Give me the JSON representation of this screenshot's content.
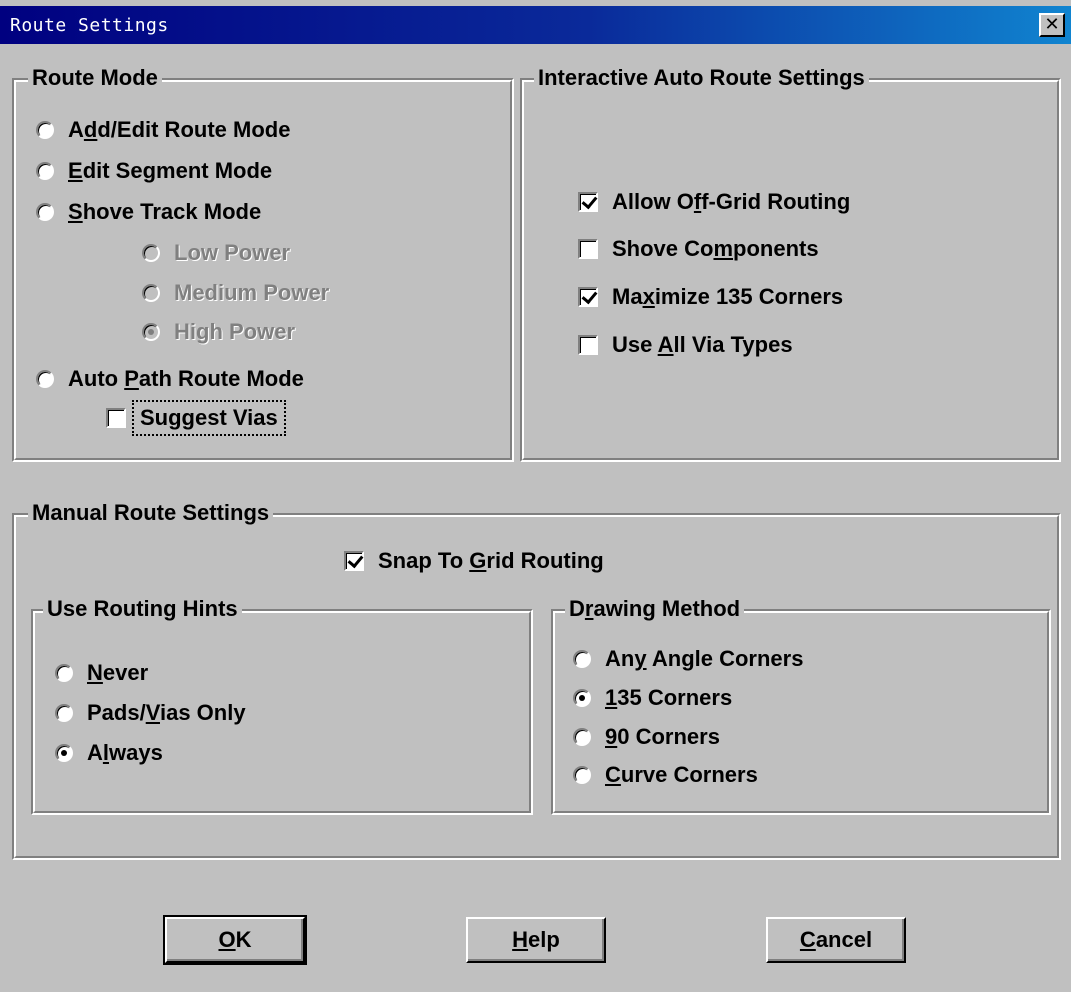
{
  "window": {
    "title": "Route Settings",
    "close_glyph": "✕"
  },
  "route_mode": {
    "legend": "Route Mode",
    "add_edit": {
      "pre": "A",
      "key": "d",
      "post": "d/Edit Route Mode"
    },
    "edit_segment": {
      "pre": "",
      "key": "E",
      "post": "dit Segment Mode"
    },
    "shove_track": {
      "pre": "",
      "key": "S",
      "post": "hove Track Mode"
    },
    "low_power": "Low Power",
    "medium_power": "Medium Power",
    "high_power": "High Power",
    "auto_path": {
      "pre": "Auto ",
      "key": "P",
      "post": "ath Route Mode"
    },
    "suggest_vias": "Suggest Vias"
  },
  "interactive": {
    "legend": "Interactive Auto Route Settings",
    "allow_offgrid": {
      "pre": "Allow O",
      "key": "f",
      "post": "f-Grid Routing"
    },
    "shove_components": {
      "pre": "Shove Co",
      "key": "m",
      "post": "ponents"
    },
    "maximize_135": {
      "pre": "Ma",
      "key": "x",
      "post": "imize 135 Corners"
    },
    "use_all_via": {
      "pre": "Use ",
      "key": "A",
      "post": "ll Via Types"
    }
  },
  "manual": {
    "legend": "Manual Route Settings",
    "snap_to_grid": {
      "pre": "Snap To ",
      "key": "G",
      "post": "rid Routing"
    },
    "hints": {
      "legend": "Use Routing Hints",
      "never": {
        "pre": "",
        "key": "N",
        "post": "ever"
      },
      "pads_vias": {
        "pre": "Pads/",
        "key": "V",
        "post": "ias Only"
      },
      "always": {
        "pre": "A",
        "key": "l",
        "post": "ways"
      }
    },
    "drawing": {
      "legend_pre": "D",
      "legend_key": "r",
      "legend_post": "awing Method",
      "any_angle": {
        "pre": "An",
        "key": "y",
        "post": " Angle Corners"
      },
      "c135": {
        "pre": "",
        "key": "1",
        "post": "35 Corners"
      },
      "c90": {
        "pre": "",
        "key": "9",
        "post": "0 Corners"
      },
      "curve": {
        "pre": "",
        "key": "C",
        "post": "urve Corners"
      }
    }
  },
  "buttons": {
    "ok": {
      "pre": "",
      "key": "O",
      "post": "K"
    },
    "help": {
      "pre": "",
      "key": "H",
      "post": "elp"
    },
    "cancel": {
      "pre": "",
      "key": "C",
      "post": "ancel"
    }
  }
}
